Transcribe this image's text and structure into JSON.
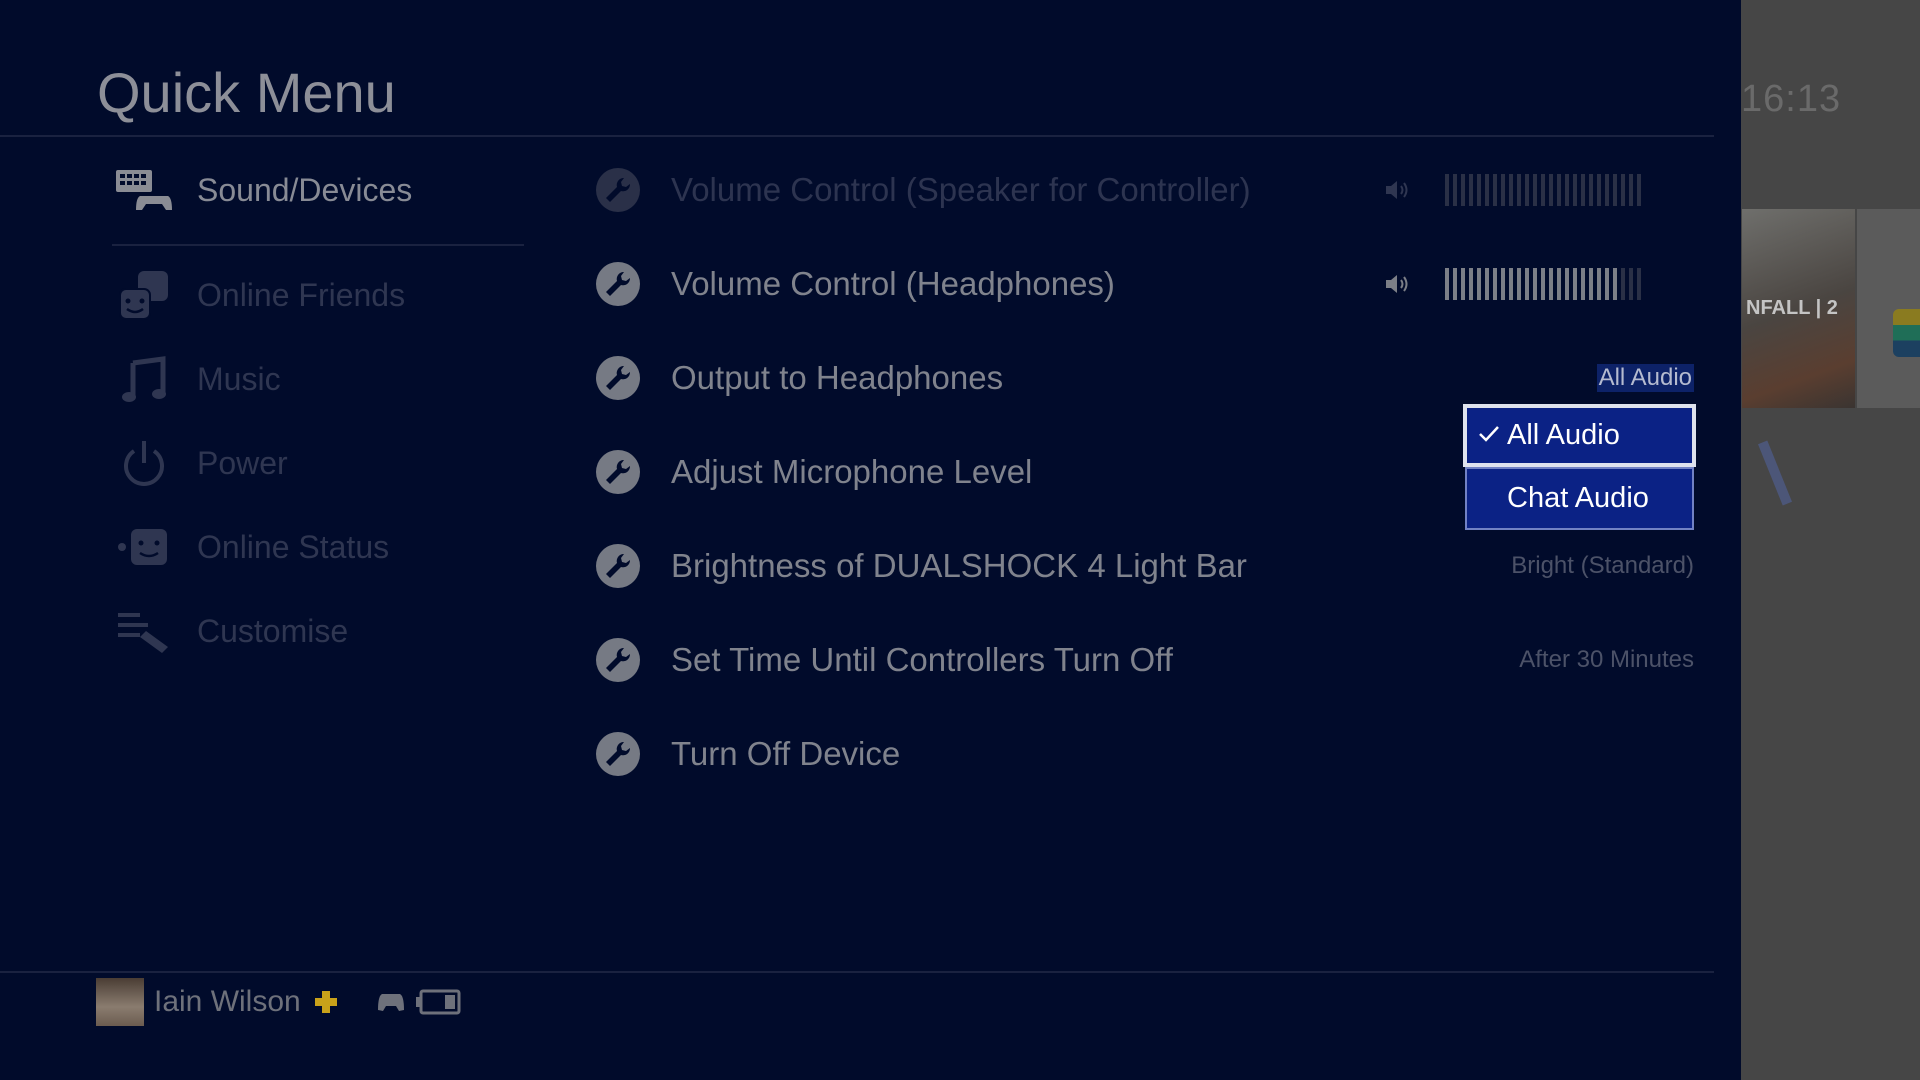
{
  "header": {
    "title": "Quick Menu",
    "clock": "16:13"
  },
  "background": {
    "game_tile_text": "NFALL | 2"
  },
  "sidebar": {
    "items": [
      {
        "label": "Sound/Devices",
        "icon": "keyboard-controller-icon",
        "selected": true
      },
      {
        "label": "Online Friends",
        "icon": "friends-icon"
      },
      {
        "label": "Music",
        "icon": "music-note-icon"
      },
      {
        "label": "Power",
        "icon": "power-icon"
      },
      {
        "label": "Online Status",
        "icon": "online-status-icon"
      },
      {
        "label": "Customise",
        "icon": "customise-icon"
      }
    ]
  },
  "settings": {
    "items": [
      {
        "label": "Volume Control (Speaker for Controller)",
        "type": "volume",
        "disabled": true,
        "level": 1.0
      },
      {
        "label": "Volume Control (Headphones)",
        "type": "volume",
        "level": 0.88
      },
      {
        "label": "Output to Headphones",
        "value": "All Audio",
        "highlighted": true
      },
      {
        "label": "Adjust Microphone Level"
      },
      {
        "label": "Brightness of DUALSHOCK 4 Light Bar",
        "value": "Bright (Standard)"
      },
      {
        "label": "Set Time Until Controllers Turn Off",
        "value": "After 30 Minutes"
      },
      {
        "label": "Turn Off Device"
      }
    ]
  },
  "dropdown": {
    "options": [
      {
        "label": "All Audio",
        "checked": true
      },
      {
        "label": "Chat Audio"
      }
    ]
  },
  "footer": {
    "user": "Iain Wilson",
    "plus_icon": "ps-plus-icon",
    "controller_icon": "controller-icon",
    "battery_icon": "battery-icon",
    "battery_level": 0.33
  },
  "colors": {
    "panel": "#010b2b",
    "dropdown": "#0b2285",
    "plus": "#c9a21a"
  }
}
